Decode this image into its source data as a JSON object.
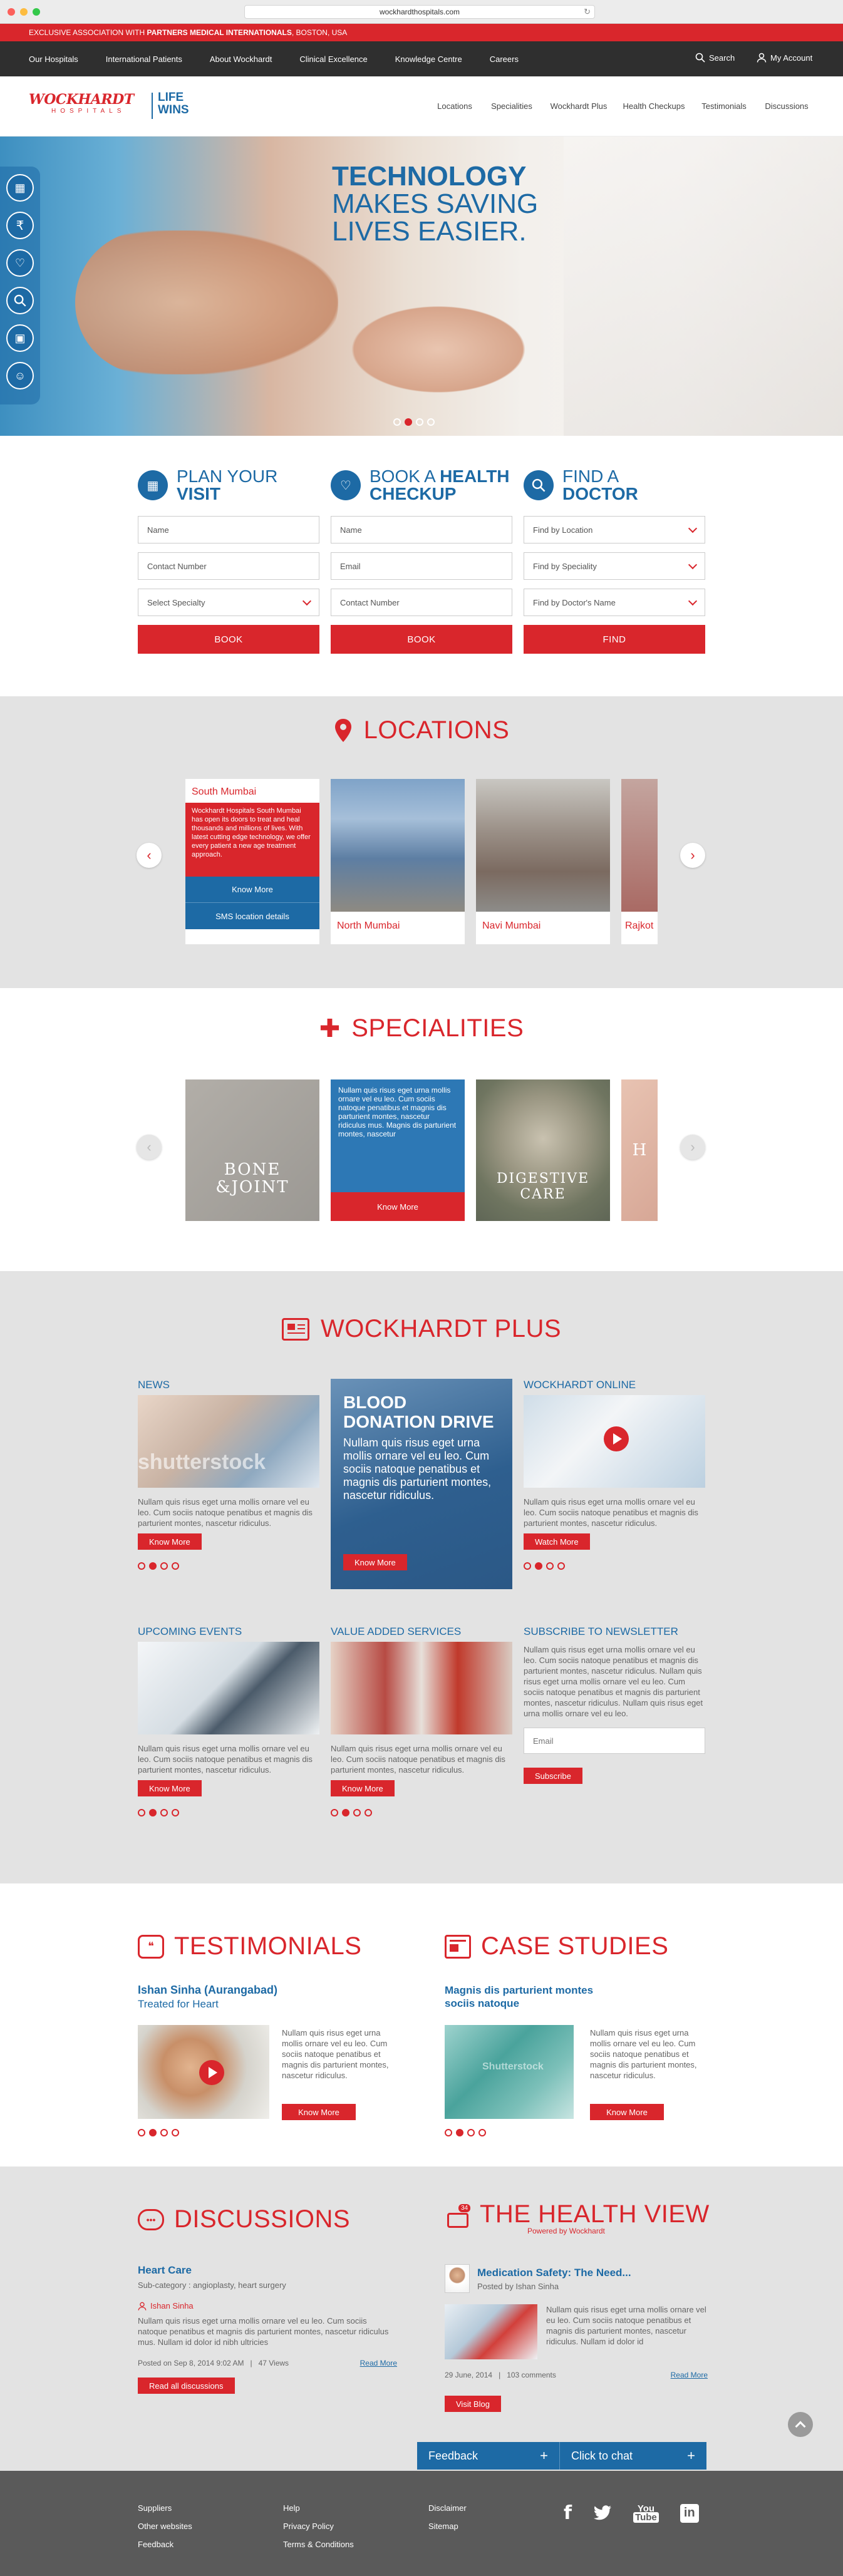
{
  "browser": {
    "url": "wockhardthospitals.com"
  },
  "topbar": {
    "prefix": "EXCLUSIVE ASSOCIATION WITH",
    "partner": "PARTNERS MEDICAL INTERNATIONALS",
    "location": ", BOSTON, USA"
  },
  "nav1": {
    "items": [
      "Our Hospitals",
      "International Patients",
      "About Wockhardt",
      "Clinical Excellence",
      "Knowledge Centre",
      "Careers"
    ],
    "search": "Search",
    "account": "My Account"
  },
  "logo": {
    "brand": "WOCKHARDT",
    "sub": "HOSPITALS",
    "tag1": "LIFE",
    "tag2": "WINS"
  },
  "nav2": {
    "items": [
      "Locations",
      "Specialities",
      "Wockhardt Plus",
      "Health Checkups",
      "Testimonials",
      "Discussions"
    ]
  },
  "hero": {
    "line1": "TECHNOLOGY",
    "line2": "MAKES SAVING",
    "line3": "LIVES EASIER."
  },
  "plan": {
    "t1": "PLAN YOUR",
    "t2": "VISIT",
    "f1": "Name",
    "f2": "Contact Number",
    "f3": "Select Specialty",
    "btn": "BOOK"
  },
  "checkup": {
    "t1": "BOOK A ",
    "t1b": "HEALTH",
    "t2": "CHECKUP",
    "f1": "Name",
    "f2": "Email",
    "f3": "Contact Number",
    "btn": "BOOK"
  },
  "doctor": {
    "t1": "FIND A",
    "t2": "DOCTOR",
    "f1": "Find by Location",
    "f2": "Find by Speciality",
    "f3": "Find by Doctor's Name",
    "btn": "FIND"
  },
  "locations": {
    "title": "LOCATIONS",
    "card_title": "South Mumbai",
    "card_text": "Wockhardt Hospitals South Mumbai has open its doors to treat and heal thousands and millions of lives. With latest cutting edge technology, we offer every patient a new age treatment approach.",
    "know_more": "Know More",
    "sms": "SMS location details",
    "c2": "North Mumbai",
    "c3": "Navi Mumbai",
    "c4": "Rajkot"
  },
  "specialities": {
    "title": "SPECIALITIES",
    "s1": "BONE\n&JOINT",
    "s2_text": "Nullam quis risus eget urna mollis ornare vel eu leo. Cum sociis natoque penatibus et magnis dis parturient montes, nascetur ridiculus mus. Magnis dis parturient montes, nascetur",
    "s2_btn": "Know More",
    "s3a": "DIGESTIVE",
    "s3b": "CARE",
    "s4": "H"
  },
  "plus": {
    "title": "WOCKHARDT PLUS",
    "news": {
      "h": "NEWS",
      "wm": "shutterstock",
      "text": "Nullam quis risus eget urna mollis ornare vel eu leo. Cum sociis natoque penatibus et magnis dis parturient montes, nascetur ridiculus.",
      "btn": "Know More"
    },
    "blood": {
      "h": "BLOOD DONATION DRIVE",
      "text": "Nullam quis risus eget urna mollis ornare vel eu leo. Cum sociis natoque penatibus et magnis dis parturient montes, nascetur ridiculus.",
      "btn": "Know More"
    },
    "online": {
      "h": "WOCKHARDT ONLINE",
      "text": "Nullam quis risus eget urna mollis ornare vel eu leo. Cum sociis natoque penatibus et magnis dis parturient montes, nascetur ridiculus.",
      "btn": "Watch More"
    },
    "events": {
      "h": "UPCOMING EVENTS",
      "text": "Nullam quis risus eget urna mollis ornare vel eu leo. Cum sociis natoque penatibus et magnis dis parturient montes, nascetur ridiculus.",
      "btn": "Know More"
    },
    "vas": {
      "h": "VALUE ADDED SERVICES",
      "text": "Nullam quis risus eget urna mollis ornare vel eu leo. Cum sociis natoque penatibus et magnis dis parturient montes, nascetur ridiculus.",
      "btn": "Know More"
    },
    "newsletter": {
      "h": "SUBSCRIBE TO NEWSLETTER",
      "text": "Nullam quis risus eget urna mollis ornare vel eu leo. Cum sociis natoque penatibus et magnis dis parturient montes, nascetur ridiculus. Nullam quis risus eget urna mollis ornare vel eu leo. Cum sociis natoque penatibus et magnis dis parturient montes, nascetur ridiculus. Nullam quis risus eget urna mollis ornare vel eu leo.",
      "placeholder": "Email",
      "btn": "Subscribe"
    }
  },
  "testimonials": {
    "title": "TESTIMONIALS",
    "name": "Ishan Sinha (Aurangabad)",
    "sub": "Treated for Heart",
    "text": "Nullam quis risus eget urna mollis ornare vel eu leo. Cum sociis natoque penatibus et magnis dis parturient montes, nascetur ridiculus.",
    "btn": "Know More"
  },
  "cases": {
    "title": "CASE STUDIES",
    "name": "Magnis dis parturient montes sociis natoque",
    "text": "Nullam quis risus eget urna mollis ornare vel eu leo. Cum sociis natoque penatibus et magnis dis parturient montes, nascetur ridiculus.",
    "btn": "Know More",
    "wm": "Shutterstock"
  },
  "discussions": {
    "title": "DISCUSSIONS",
    "topic": "Heart Care",
    "subcat": "Sub-category : angioplasty, heart surgery",
    "author": "Ishan Sinha",
    "text": "Nullam quis risus eget urna mollis ornare vel eu leo. Cum sociis natoque penatibus et magnis dis parturient montes, nascetur ridiculus mus. Nullam id dolor id nibh ultricies",
    "meta": "Posted on Sep 8, 2014 9:02 AM   |   47 Views",
    "read": "Read More",
    "btn": "Read all discussions"
  },
  "healthview": {
    "title": "THE HEALTH VIEW",
    "powered": "Powered by Wockhardt",
    "post": "Medication Safety: The Need...",
    "by": "Posted by Ishan Sinha",
    "text": "Nullam quis risus eget urna mollis ornare vel eu leo. Cum sociis natoque penatibus et magnis dis parturient montes, nascetur ridiculus. Nullam id dolor id",
    "meta": "29 June, 2014   |   103 comments",
    "read": "Read More",
    "btn": "Visit Blog",
    "badge": "34"
  },
  "feedback": {
    "label": "Feedback",
    "chat": "Click to chat"
  },
  "footer": {
    "col1": [
      "Suppliers",
      "Other websites",
      "Feedback"
    ],
    "col2": [
      "Help",
      "Privacy Policy",
      "Terms & Conditions"
    ],
    "col3": [
      "Disclaimer",
      "Sitemap"
    ]
  }
}
